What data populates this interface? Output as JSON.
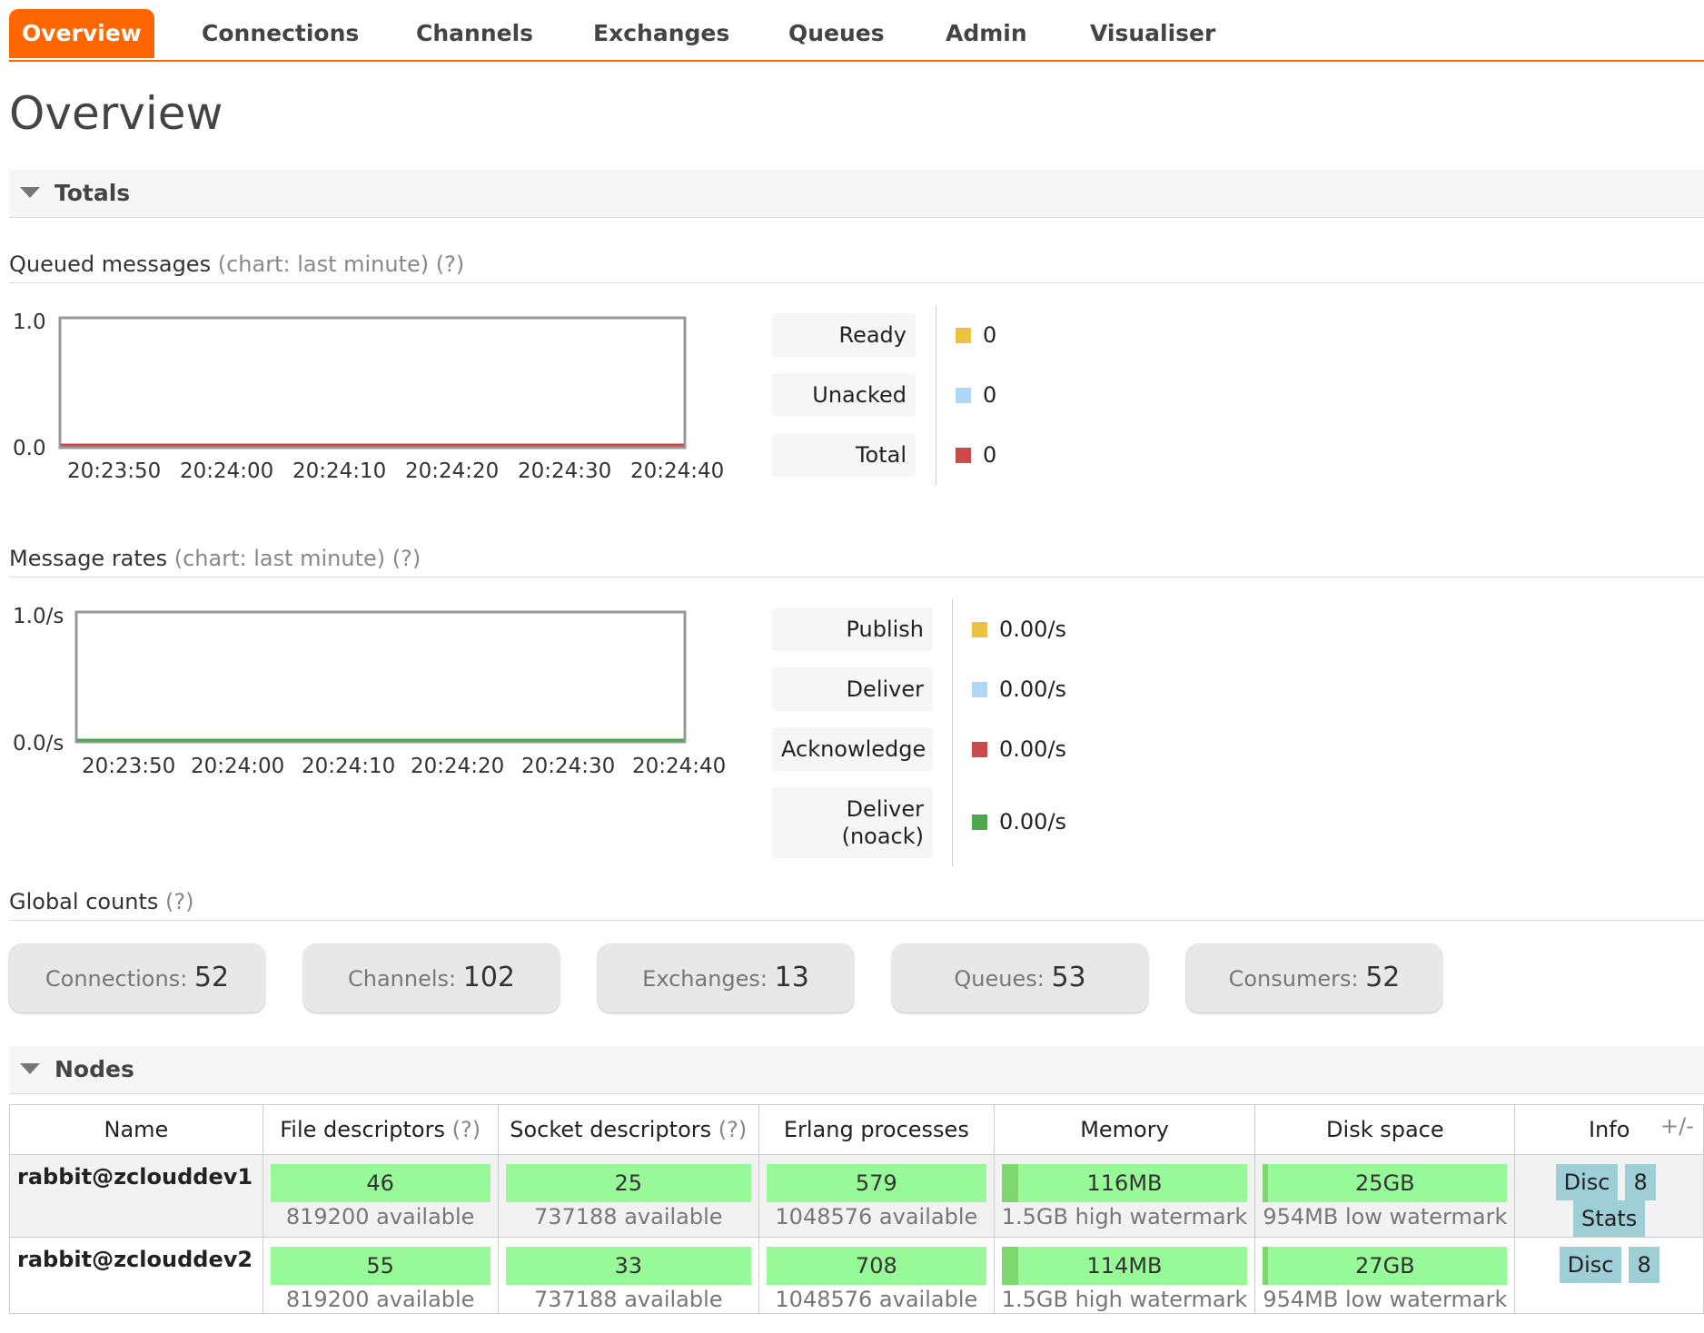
{
  "nav": {
    "tabs": [
      "Overview",
      "Connections",
      "Channels",
      "Exchanges",
      "Queues",
      "Admin",
      "Visualiser"
    ],
    "active": "Overview"
  },
  "page_title": "Overview",
  "totals": {
    "title": "Totals"
  },
  "queued": {
    "label": "Queued messages",
    "hint": "(chart: last minute)",
    "help": "(?)",
    "y_top": "1.0",
    "y_bottom": "0.0",
    "x_ticks": [
      "20:23:50",
      "20:24:00",
      "20:24:10",
      "20:24:20",
      "20:24:30",
      "20:24:40"
    ],
    "legend": [
      {
        "label": "Ready",
        "value": "0",
        "color": "#edc240"
      },
      {
        "label": "Unacked",
        "value": "0",
        "color": "#afd8f8"
      },
      {
        "label": "Total",
        "value": "0",
        "color": "#cb4b4b"
      }
    ]
  },
  "rates": {
    "label": "Message rates",
    "hint": "(chart: last minute)",
    "help": "(?)",
    "y_top": "1.0/s",
    "y_bottom": "0.0/s",
    "x_ticks": [
      "20:23:50",
      "20:24:00",
      "20:24:10",
      "20:24:20",
      "20:24:30",
      "20:24:40"
    ],
    "legend": [
      {
        "label": "Publish",
        "value": "0.00/s",
        "color": "#edc240"
      },
      {
        "label": "Deliver",
        "value": "0.00/s",
        "color": "#afd8f8"
      },
      {
        "label": "Acknowledge",
        "value": "0.00/s",
        "color": "#cb4b4b"
      },
      {
        "label": "Deliver (noack)",
        "label_line1": "Deliver",
        "label_line2": "(noack)",
        "value": "0.00/s",
        "color": "#4da74d"
      }
    ]
  },
  "global": {
    "label": "Global counts",
    "help": "(?)",
    "counts": [
      {
        "label": "Connections:",
        "value": "52"
      },
      {
        "label": "Channels:",
        "value": "102"
      },
      {
        "label": "Exchanges:",
        "value": "13"
      },
      {
        "label": "Queues:",
        "value": "53"
      },
      {
        "label": "Consumers:",
        "value": "52"
      }
    ]
  },
  "nodes": {
    "title": "Nodes",
    "plus_minus": "+/-",
    "headers": {
      "name": "Name",
      "fd": "File descriptors",
      "sd": "Socket descriptors",
      "help": "(?)",
      "erlang": "Erlang processes",
      "memory": "Memory",
      "disk": "Disk space",
      "info": "Info"
    },
    "rows": [
      {
        "name": "rabbit@zclouddev1",
        "fd": "46",
        "fd_avail": "819200 available",
        "sd": "25",
        "sd_avail": "737188 available",
        "erlang": "579",
        "erlang_avail": "1048576 available",
        "memory": "116MB",
        "memory_sub": "1.5GB high watermark",
        "disk": "25GB",
        "disk_sub": "954MB low watermark",
        "info": [
          "Disc",
          "8",
          "Stats"
        ]
      },
      {
        "name": "rabbit@zclouddev2",
        "fd": "55",
        "fd_avail": "819200 available",
        "sd": "33",
        "sd_avail": "737188 available",
        "erlang": "708",
        "erlang_avail": "1048576 available",
        "memory": "114MB",
        "memory_sub": "1.5GB high watermark",
        "disk": "27GB",
        "disk_sub": "954MB low watermark",
        "info": [
          "Disc",
          "8"
        ]
      }
    ]
  }
}
